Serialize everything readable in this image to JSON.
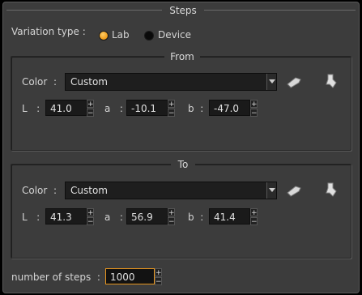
{
  "dialog": {
    "title": "Steps"
  },
  "variation": {
    "label": "Variation type",
    "sep": ":",
    "options": [
      {
        "label": "Lab",
        "selected": true
      },
      {
        "label": "Device",
        "selected": false
      }
    ]
  },
  "from": {
    "title": "From",
    "color_label": "Color",
    "sep": ":",
    "color_value": "Custom",
    "l_label": "L",
    "l_value": "41.0",
    "a_label": "a",
    "a_value": "-10.1",
    "b_label": "b",
    "b_value": "-47.0",
    "plus": "+",
    "minus": "−"
  },
  "to": {
    "title": "To",
    "color_label": "Color",
    "sep": ":",
    "color_value": "Custom",
    "l_label": "L",
    "l_value": "41.3",
    "a_label": "a",
    "a_value": "56.9",
    "b_label": "b",
    "b_value": "41.4",
    "plus": "+",
    "minus": "−"
  },
  "steps": {
    "label": "number of steps",
    "sep": ":",
    "value": "1000",
    "plus": "+",
    "minus": "−"
  },
  "colors": {
    "accent": "#f0a020",
    "panel": "#3c3c3c",
    "field": "#1a1a1a"
  }
}
